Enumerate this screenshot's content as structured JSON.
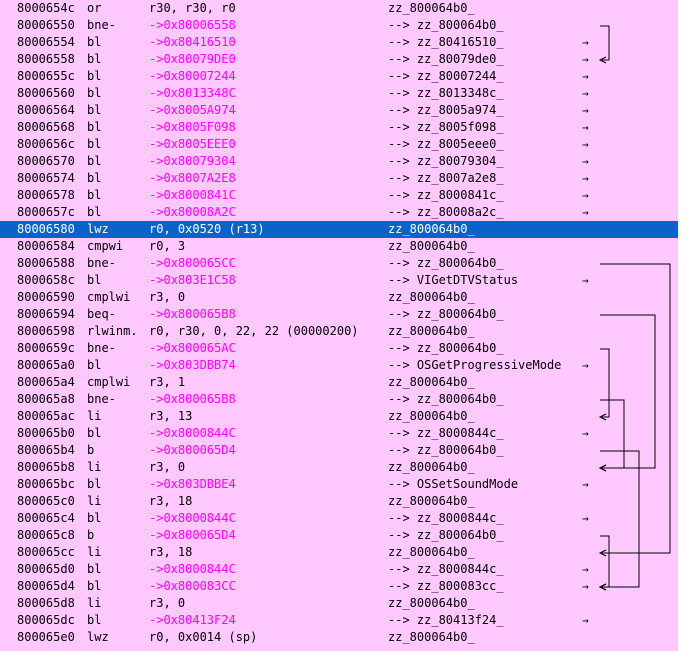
{
  "rows": [
    {
      "addr": "8000654c",
      "mnemonic": "or",
      "operands": "r30, r30, r0",
      "target": "zz_800064b0_"
    },
    {
      "addr": "80006550",
      "mnemonic": "bne-",
      "operands": "->0x80006558",
      "target": "--> zz_800064b0_",
      "branch": true
    },
    {
      "addr": "80006554",
      "mnemonic": "bl",
      "operands": "->0x80416510",
      "target": "--> zz_80416510_",
      "branch": true
    },
    {
      "addr": "80006558",
      "mnemonic": "bl",
      "operands": "->0x80079DE0",
      "target": "--> zz_80079de0_",
      "branch": true
    },
    {
      "addr": "8000655c",
      "mnemonic": "bl",
      "operands": "->0x80007244",
      "target": "--> zz_80007244_",
      "branch": true
    },
    {
      "addr": "80006560",
      "mnemonic": "bl",
      "operands": "->0x8013348C",
      "target": "--> zz_8013348c_",
      "branch": true
    },
    {
      "addr": "80006564",
      "mnemonic": "bl",
      "operands": "->0x8005A974",
      "target": "--> zz_8005a974_",
      "branch": true
    },
    {
      "addr": "80006568",
      "mnemonic": "bl",
      "operands": "->0x8005F098",
      "target": "--> zz_8005f098_",
      "branch": true
    },
    {
      "addr": "8000656c",
      "mnemonic": "bl",
      "operands": "->0x8005EEE0",
      "target": "--> zz_8005eee0_",
      "branch": true
    },
    {
      "addr": "80006570",
      "mnemonic": "bl",
      "operands": "->0x80079304",
      "target": "--> zz_80079304_",
      "branch": true
    },
    {
      "addr": "80006574",
      "mnemonic": "bl",
      "operands": "->0x8007A2E8",
      "target": "--> zz_8007a2e8_",
      "branch": true
    },
    {
      "addr": "80006578",
      "mnemonic": "bl",
      "operands": "->0x8000841C",
      "target": "--> zz_8000841c_",
      "branch": true
    },
    {
      "addr": "8000657c",
      "mnemonic": "bl",
      "operands": "->0x80008A2C",
      "target": "--> zz_80008a2c_",
      "branch": true
    },
    {
      "addr": "80006580",
      "mnemonic": "lwz",
      "operands": "r0, 0x0520 (r13)",
      "target": "zz_800064b0_",
      "selected": true
    },
    {
      "addr": "80006584",
      "mnemonic": "cmpwi",
      "operands": "r0, 3",
      "target": "zz_800064b0_"
    },
    {
      "addr": "80006588",
      "mnemonic": "bne-",
      "operands": "->0x800065CC",
      "target": "--> zz_800064b0_",
      "branch": true
    },
    {
      "addr": "8000658c",
      "mnemonic": "bl",
      "operands": "->0x803E1C58",
      "target": "--> VIGetDTVStatus",
      "branch": true
    },
    {
      "addr": "80006590",
      "mnemonic": "cmplwi",
      "operands": "r3, 0",
      "target": "zz_800064b0_"
    },
    {
      "addr": "80006594",
      "mnemonic": "beq-",
      "operands": "->0x800065B8",
      "target": "--> zz_800064b0_",
      "branch": true
    },
    {
      "addr": "80006598",
      "mnemonic": "rlwinm.",
      "operands": "r0, r30, 0, 22, 22 (00000200)",
      "target": "zz_800064b0_"
    },
    {
      "addr": "8000659c",
      "mnemonic": "bne-",
      "operands": "->0x800065AC",
      "target": "--> zz_800064b0_",
      "branch": true
    },
    {
      "addr": "800065a0",
      "mnemonic": "bl",
      "operands": "->0x803DBB74",
      "target": "--> OSGetProgressiveMode",
      "branch": true
    },
    {
      "addr": "800065a4",
      "mnemonic": "cmplwi",
      "operands": "r3, 1",
      "target": "zz_800064b0_"
    },
    {
      "addr": "800065a8",
      "mnemonic": "bne-",
      "operands": "->0x800065B8",
      "target": "--> zz_800064b0_",
      "branch": true
    },
    {
      "addr": "800065ac",
      "mnemonic": "li",
      "operands": "r3, 13",
      "target": "zz_800064b0_"
    },
    {
      "addr": "800065b0",
      "mnemonic": "bl",
      "operands": "->0x8000844C",
      "target": "--> zz_8000844c_",
      "branch": true
    },
    {
      "addr": "800065b4",
      "mnemonic": "b",
      "operands": "->0x800065D4",
      "target": "--> zz_800064b0_",
      "branch": true
    },
    {
      "addr": "800065b8",
      "mnemonic": "li",
      "operands": "r3, 0",
      "target": "zz_800064b0_"
    },
    {
      "addr": "800065bc",
      "mnemonic": "bl",
      "operands": "->0x803DBBE4",
      "target": "--> OSSetSoundMode",
      "branch": true
    },
    {
      "addr": "800065c0",
      "mnemonic": "li",
      "operands": "r3, 18",
      "target": "zz_800064b0_"
    },
    {
      "addr": "800065c4",
      "mnemonic": "bl",
      "operands": "->0x8000844C",
      "target": "--> zz_8000844c_",
      "branch": true
    },
    {
      "addr": "800065c8",
      "mnemonic": "b",
      "operands": "->0x800065D4",
      "target": "--> zz_800064b0_",
      "branch": true
    },
    {
      "addr": "800065cc",
      "mnemonic": "li",
      "operands": "r3, 18",
      "target": "zz_800064b0_"
    },
    {
      "addr": "800065d0",
      "mnemonic": "bl",
      "operands": "->0x8000844C",
      "target": "--> zz_8000844c_",
      "branch": true
    },
    {
      "addr": "800065d4",
      "mnemonic": "bl",
      "operands": "->0x800083CC",
      "target": "--> zz_800083cc_",
      "branch": true
    },
    {
      "addr": "800065d8",
      "mnemonic": "li",
      "operands": "r3, 0",
      "target": "zz_800064b0_"
    },
    {
      "addr": "800065dc",
      "mnemonic": "bl",
      "operands": "->0x80413F24",
      "target": "--> zz_80413f24_",
      "branch": true
    },
    {
      "addr": "800065e0",
      "mnemonic": "lwz",
      "operands": "r0, 0x0014 (sp)",
      "target": "zz_800064b0_"
    }
  ],
  "colors": {
    "background": "#ffc8ff",
    "branch": "#ff00ff",
    "selection": "#0a64c8"
  },
  "arrow_glyph": "→",
  "icons": {
    "call_arrow": "right-arrow-icon",
    "branch_line": "branch-flow-line"
  }
}
